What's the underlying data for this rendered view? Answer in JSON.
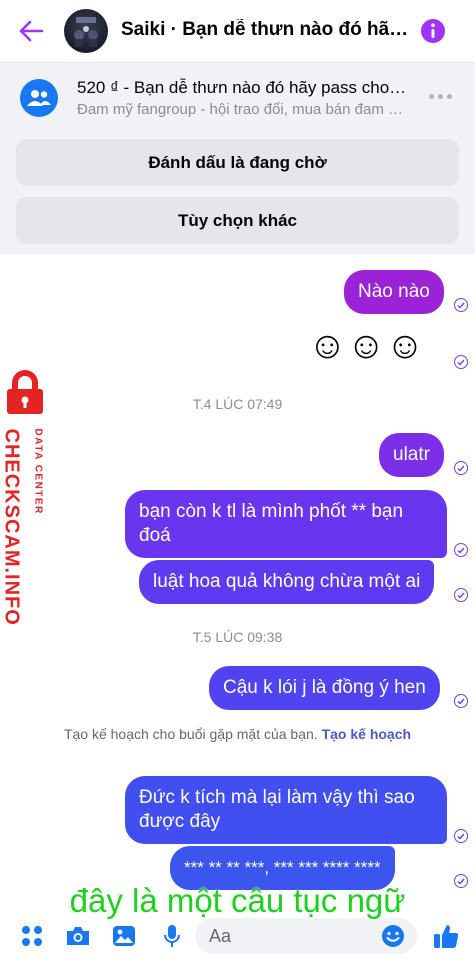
{
  "header": {
    "title": "Saiki · Bạn dễ thưn nào đó hãy pass cho mình",
    "back_icon": "arrow-left-icon",
    "info_icon": "info-icon",
    "accent": "#a033ff"
  },
  "listing": {
    "title": "520 ₫ - Bạn dễ thưn nào đó hãy pass cho mình",
    "subtitle": "Đam mỹ fangroup - hội trao đổi, mua bán đam mỹ",
    "mark_pending_label": "Đánh dấu là đang chờ",
    "more_options_label": "Tùy chọn khác"
  },
  "messages": [
    {
      "text": "Nào nào",
      "color": "#9b22d6"
    },
    {
      "text": "☺☺☺"
    },
    {
      "text": "ulatr",
      "color": "#7c2ee8"
    },
    {
      "text": "bạn còn k tl là mình phốt ** bạn đoá",
      "color": "#6a35ee"
    },
    {
      "text": "luật hoa quả không chừa một ai",
      "color": "#5e3bf0"
    },
    {
      "text": "Cậu k lói j là đồng ý hen",
      "color": "#4f44f0"
    },
    {
      "text": "Đức k tích mà lại làm vậy thì sao được đây",
      "color": "#414ff0"
    },
    {
      "text": "*** ** ** ***, *** *** **** ****",
      "color": "#3b55ef"
    }
  ],
  "timestamps": [
    "T.4 LÚC 07:49",
    "T.5 LÚC 09:38"
  ],
  "system_notice": {
    "text": "Tạo kế hoạch cho buổi gặp mặt của bạn.",
    "link": "Tạo kế hoạch"
  },
  "watermark": {
    "brand": "CHECKSCAM.INFO",
    "sub": "DATA CENTER",
    "color": "#e42424"
  },
  "caption": "đây là một câu tục ngữ",
  "composer": {
    "placeholder": "Aa",
    "icons": [
      "menu-dots-icon",
      "camera-icon",
      "image-icon",
      "microphone-icon",
      "emoji-icon",
      "thumbs-up-icon"
    ]
  }
}
